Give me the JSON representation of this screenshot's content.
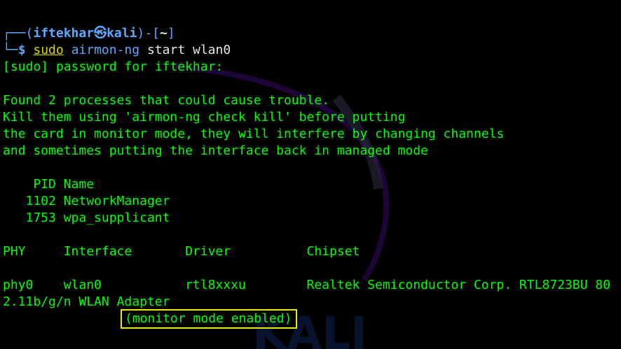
{
  "prompt": {
    "corner_top": "┌──(",
    "user": "iftekhar",
    "at_symbol": "㉿",
    "host": "kali",
    "sep": ")-[",
    "dir": "~",
    "close": "]",
    "corner_bottom": "└─",
    "dollar": "$",
    "cmd_sudo": "sudo",
    "cmd_bin": "airmon-ng",
    "cmd_args": "start wlan0"
  },
  "output": {
    "sudo_prompt": "[sudo] password for iftekhar:",
    "found": "Found 2 processes that could cause trouble.",
    "kill1": "Kill them using 'airmon-ng check kill' before putting",
    "kill2": "the card in monitor mode, they will interfere by changing channels",
    "kill3": "and sometimes putting the interface back in managed mode",
    "pid_header": "    PID Name",
    "processes": [
      "   1102 NetworkManager",
      "   1753 wpa_supplicant"
    ],
    "table_header": "PHY     Interface       Driver          Chipset",
    "table_row1": "phy0    wlan0           rtl8xxxu        Realtek Semiconductor Corp. RTL8723BU 80",
    "table_row2": "2.11b/g/n WLAN Adapter",
    "monitor_mode": "(monitor mode enabled)"
  },
  "background": {
    "logo_text": "KALI"
  },
  "colors": {
    "background": "#000000",
    "text": "#00ff00",
    "path_blue": "#5aa9ff",
    "highlight": "#e8e800"
  }
}
